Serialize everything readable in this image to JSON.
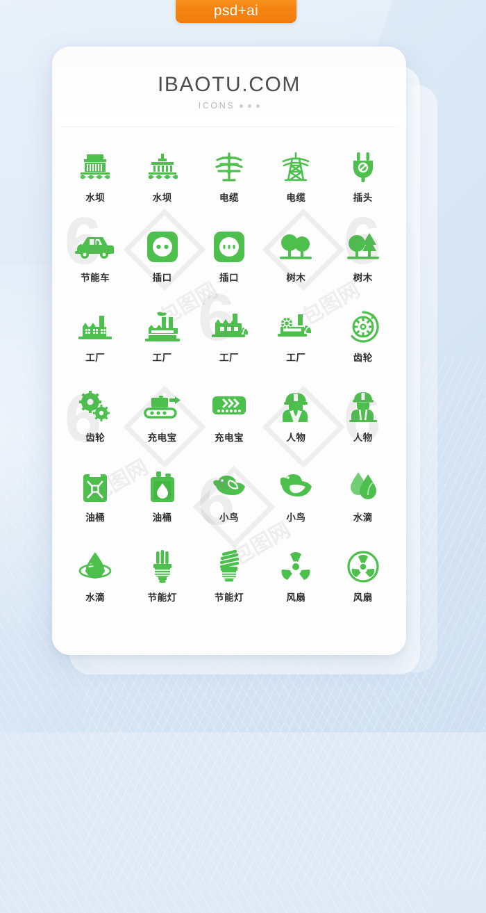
{
  "badge": {
    "label": "psd+ai",
    "color": "#f58413"
  },
  "card": {
    "brand": "IBAOTU.COM",
    "subtitle": "ICONS",
    "accent": "#4cbf4c"
  },
  "icons": [
    {
      "label": "水坝",
      "name": "dam-icon"
    },
    {
      "label": "水坝",
      "name": "dam-alt-icon"
    },
    {
      "label": "电缆",
      "name": "power-pylon-icon"
    },
    {
      "label": "电缆",
      "name": "power-tower-icon"
    },
    {
      "label": "插头",
      "name": "plug-icon"
    },
    {
      "label": "节能车",
      "name": "eco-car-icon"
    },
    {
      "label": "插口",
      "name": "socket-two-hole-icon"
    },
    {
      "label": "插口",
      "name": "socket-three-hole-icon"
    },
    {
      "label": "树木",
      "name": "trees-icon"
    },
    {
      "label": "树木",
      "name": "tree-pine-icon"
    },
    {
      "label": "工厂",
      "name": "factory-icon"
    },
    {
      "label": "工厂",
      "name": "factory-smoke-icon"
    },
    {
      "label": "工厂",
      "name": "factory-leaf-icon"
    },
    {
      "label": "工厂",
      "name": "factory-eco-icon"
    },
    {
      "label": "齿轮",
      "name": "gear-recycle-icon"
    },
    {
      "label": "齿轮",
      "name": "gears-icon"
    },
    {
      "label": "充电宝",
      "name": "conveyor-icon"
    },
    {
      "label": "充电宝",
      "name": "power-bank-icon"
    },
    {
      "label": "人物",
      "name": "worker-icon"
    },
    {
      "label": "人物",
      "name": "worker-alt-icon"
    },
    {
      "label": "油桶",
      "name": "jerrycan-icon"
    },
    {
      "label": "油桶",
      "name": "jerrycan-drop-icon"
    },
    {
      "label": "小鸟",
      "name": "bird-icon"
    },
    {
      "label": "小鸟",
      "name": "bird-alt-icon"
    },
    {
      "label": "水滴",
      "name": "water-drops-icon"
    },
    {
      "label": "水滴",
      "name": "water-drop-ripple-icon"
    },
    {
      "label": "节能灯",
      "name": "energy-lamp-icon"
    },
    {
      "label": "节能灯",
      "name": "spiral-lamp-icon"
    },
    {
      "label": "风扇",
      "name": "fan-icon"
    },
    {
      "label": "风扇",
      "name": "fan-circle-icon"
    }
  ],
  "watermarks": {
    "mark": "6",
    "text": "包图网"
  }
}
